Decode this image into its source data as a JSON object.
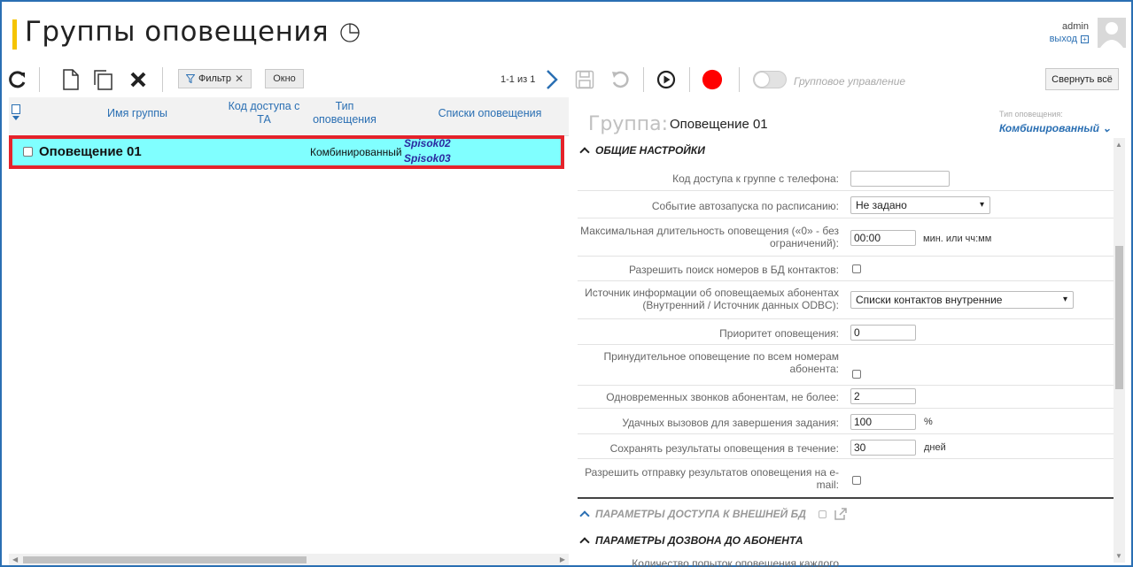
{
  "header": {
    "title": "Группы оповещения",
    "user": "admin",
    "logout": "выход"
  },
  "toolbar": {
    "filter_label": "Фильтр",
    "window_label": "Окно",
    "pager": "1-1 из 1",
    "group_control_label": "Групповое управление",
    "collapse_all_label": "Свернуть всё",
    "record_color": "#ff0000"
  },
  "table": {
    "columns": [
      "Имя группы",
      "Код доступа с ТА",
      "Тип оповещения",
      "Списки оповещения"
    ],
    "rows": [
      {
        "name": "Оповещение 01",
        "access_code": "",
        "type": "Комбинированный",
        "lists": [
          "Spisok02",
          "Spisok03"
        ],
        "selected": true
      }
    ],
    "selected_bg": "#80ffff",
    "highlight_border": "#e5232b"
  },
  "panel": {
    "group_label": "Группа:",
    "group_name": "Оповещение 01",
    "type_caption": "Тип оповещения:",
    "type_value": "Комбинированный",
    "section_general": "ОБЩИЕ НАСТРОЙКИ",
    "section_db": "ПАРАМЕТРЫ ДОСТУПА К ВНЕШНЕЙ БД",
    "section_dial": "ПАРАМЕТРЫ ДОЗВОНА ДО АБОНЕНТА",
    "fields": {
      "access_code": {
        "label": "Код доступа к группе с телефона:",
        "value": ""
      },
      "autostart": {
        "label": "Событие автозапуска по расписанию:",
        "value": "Не задано"
      },
      "max_duration": {
        "label": "Максимальная длительность оповещения («0» - без ограничений):",
        "value": "00:00",
        "unit": "мин. или чч:мм"
      },
      "db_search": {
        "label": "Разрешить поиск номеров в БД контактов:"
      },
      "source": {
        "label": "Источник информации об оповещаемых абонентах (Внутренний / Источник данных ODBC):",
        "value": "Списки контактов внутренние"
      },
      "priority": {
        "label": "Приоритет оповещения:",
        "value": "0"
      },
      "forced": {
        "label": "Принудительное оповещение по всем номерам абонента:"
      },
      "simultaneous": {
        "label": "Одновременных звонков абонентам, не более:",
        "value": "2"
      },
      "success": {
        "label": "Удачных вызовов для завершения задания:",
        "value": "100",
        "unit": "%"
      },
      "keep_results": {
        "label": "Сохранять результаты оповещения в течение:",
        "value": "30",
        "unit": "дней"
      },
      "email": {
        "label": "Разрешить отправку результатов оповещения на e-mail:"
      },
      "attempts": {
        "label": "Количество попыток оповещения каждого"
      }
    }
  }
}
